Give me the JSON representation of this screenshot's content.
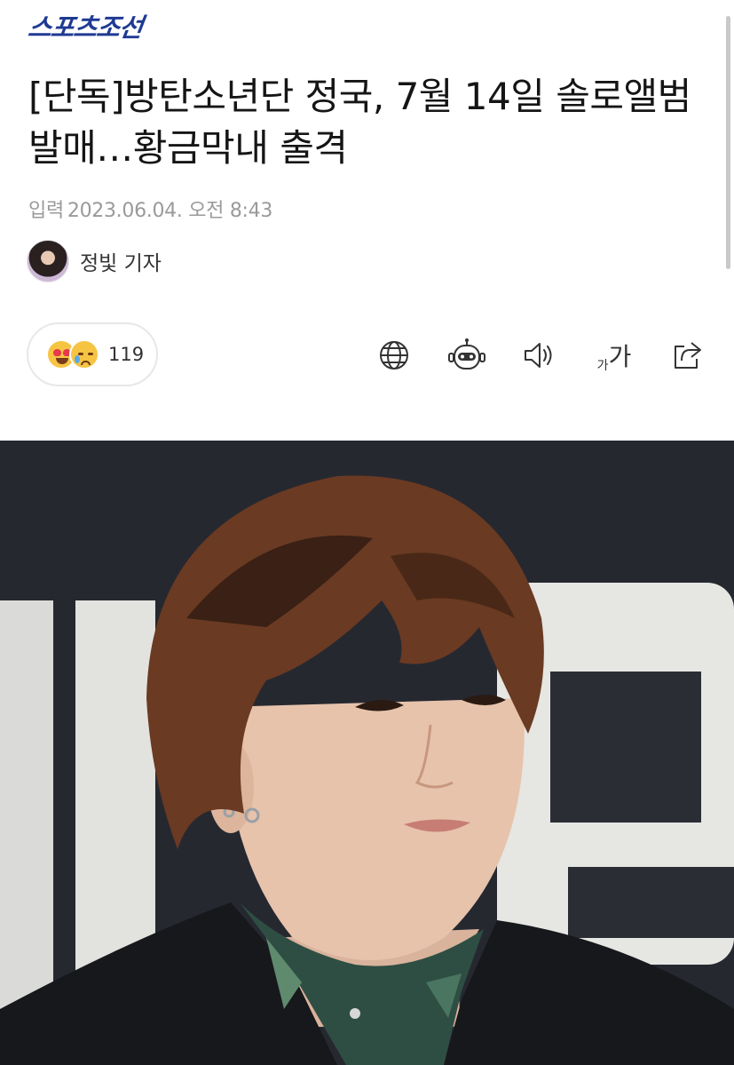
{
  "brand": {
    "logo_text": "스포츠조선",
    "logo_color": "#1f3a93"
  },
  "article": {
    "headline": "[단독]방탄소년단 정국, 7월 14일 솔로앨범 발매…황금막내 출격",
    "date_label": "입력",
    "date_value": "2023.06.04. 오전 8:43",
    "reporter": "정빛 기자"
  },
  "reactions": {
    "emojis": [
      "heart-eyes-emoji-icon",
      "crying-face-emoji-icon"
    ],
    "count": "119"
  },
  "toolbar": {
    "icons": [
      "globe-icon",
      "robot-summary-icon",
      "speaker-icon",
      "font-size-icon",
      "share-icon"
    ],
    "font_small": "가",
    "font_large": "가"
  }
}
